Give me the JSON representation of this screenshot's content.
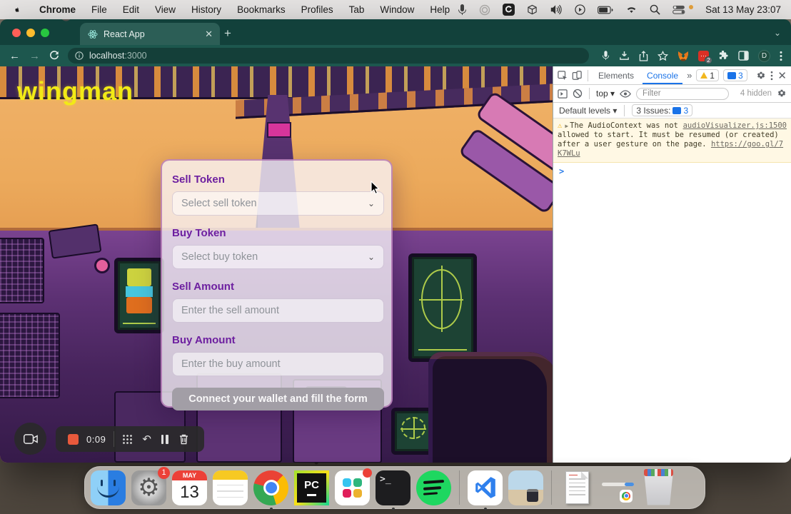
{
  "menu_bar": {
    "app_name": "Chrome",
    "items": [
      "File",
      "Edit",
      "View",
      "History",
      "Bookmarks",
      "Profiles",
      "Tab",
      "Window",
      "Help"
    ],
    "clock": "Sat 13 May 23:07"
  },
  "browser": {
    "tab_title": "React App",
    "close_tab": "✕",
    "new_tab": "+",
    "url_host": "localhost",
    "url_port": ":3000",
    "profile_initial": "D",
    "extension_badge": "2",
    "extension_dots": "⋯"
  },
  "page": {
    "logo": "wingman",
    "form": {
      "sell_token_label": "Sell Token",
      "sell_token_placeholder": "Select sell token",
      "buy_token_label": "Buy Token",
      "buy_token_placeholder": "Select buy token",
      "sell_amount_label": "Sell Amount",
      "sell_amount_placeholder": "Enter the sell amount",
      "buy_amount_label": "Buy Amount",
      "buy_amount_placeholder": "Enter the buy amount",
      "submit_label": "Connect your wallet and fill the form"
    }
  },
  "devtools": {
    "tabs": {
      "elements": "Elements",
      "console": "Console"
    },
    "more_tabs": "»",
    "warning_count": "1",
    "message_count": "3",
    "context_selector": "top",
    "filter_placeholder": "Filter",
    "hidden_label": "4 hidden",
    "levels_label": "Default levels",
    "issues_label": "3 Issues:",
    "issues_count": "3",
    "warning": {
      "expand": "▶",
      "text": "The AudioContext was not allowed to start. It must be resumed (or created) after a user gesture on the page. ",
      "link": "https://goo.gl/7K7WLu",
      "source": "audioVisualizer.js:1500"
    },
    "prompt": ">"
  },
  "recorder": {
    "time": "0:09"
  },
  "dock": {
    "calendar_month": "MAY",
    "calendar_day": "13",
    "settings_badge": "1",
    "terminal_glyph": ">_",
    "pycharm_label": "PC"
  },
  "colors": {
    "accent_purple": "#6d1fa0",
    "logo_yellow": "#f2ea16",
    "tabstrip_teal": "#12413b",
    "toolbar_teal": "#1d574e",
    "devtools_active_blue": "#1a73e8",
    "warning_bg": "#fff8e4",
    "record_red": "#e8593c"
  }
}
